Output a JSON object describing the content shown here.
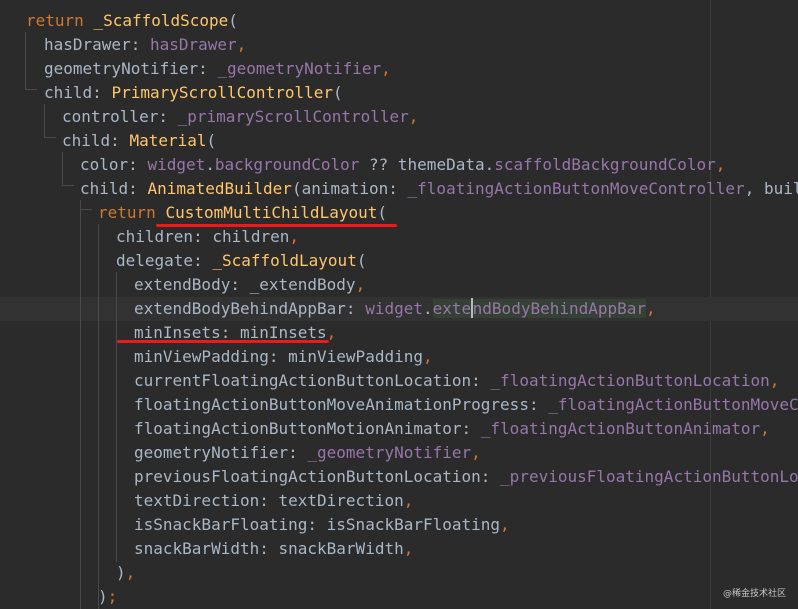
{
  "colors": {
    "background": "#2b2b2b",
    "keyword": "#cc7832",
    "class_name": "#ffc66d",
    "plain_text": "#a9b7c6",
    "field": "#9876aa",
    "annotation_underline": "#ee1a1a"
  },
  "watermark": "@稀金技术社区",
  "code": {
    "l1": {
      "a": "return",
      "b": "_ScaffoldScope",
      "c": "("
    },
    "l2": {
      "a": "hasDrawer: ",
      "b": "hasDrawer",
      "c": ","
    },
    "l3": {
      "a": "geometryNotifier: ",
      "b": "_geometryNotifier",
      "c": ","
    },
    "l4": {
      "a": "child: ",
      "b": "PrimaryScrollController",
      "c": "("
    },
    "l5": {
      "a": "controller: ",
      "b": "_primaryScrollController",
      "c": ","
    },
    "l6": {
      "a": "child: ",
      "b": "Material",
      "c": "("
    },
    "l7": {
      "a": "color: ",
      "b": "widget",
      "c": ".",
      "d": "backgroundColor",
      "e": " ?? themeData.",
      "f": "scaffoldBackgroundColor",
      "g": ","
    },
    "l8": {
      "a": "child: ",
      "b": "AnimatedBuilder",
      "c": "(animation: ",
      "d": "_floatingActionButtonMoveController",
      "e": ", builder: "
    },
    "l9": {
      "a": "return",
      "b": "CustomMultiChildLayout",
      "c": "("
    },
    "l10": {
      "a": "children: children",
      "b": ","
    },
    "l11": {
      "a": "delegate: ",
      "b": "_ScaffoldLayout",
      "c": "("
    },
    "l12": {
      "a": "extendBody: ",
      "b": "_extendBody",
      "c": ","
    },
    "l13": {
      "a": "extendBodyBehindAppBar: ",
      "b": "widget",
      "c": ".",
      "d1": "exte",
      "d2": "ndBodyBehindAppBar",
      "e": ","
    },
    "l14": {
      "a": "minInsets: minInsets",
      "b": ","
    },
    "l15": {
      "a": "minViewPadding: minViewPadding",
      "b": ","
    },
    "l16": {
      "a": "currentFloatingActionButtonLocation: ",
      "b": "_floatingActionButtonLocation",
      "c": ","
    },
    "l17": {
      "a": "floatingActionButtonMoveAnimationProgress: ",
      "b": "_floatingActionButtonMoveContro"
    },
    "l18": {
      "a": "floatingActionButtonMotionAnimator: ",
      "b": "_floatingActionButtonAnimator",
      "c": ","
    },
    "l19": {
      "a": "geometryNotifier: ",
      "b": "_geometryNotifier",
      "c": ","
    },
    "l20": {
      "a": "previousFloatingActionButtonLocation: ",
      "b": "_previousFloatingActionButtonLocatio"
    },
    "l21": {
      "a": "textDirection: textDirection",
      "b": ","
    },
    "l22": {
      "a": "isSnackBarFloating: isSnackBarFloating",
      "b": ","
    },
    "l23": {
      "a": "snackBarWidth: snackBarWidth",
      "b": ","
    },
    "l24": {
      "a": ")",
      "b": ","
    },
    "l25": {
      "a": ")",
      "b": ";"
    }
  }
}
